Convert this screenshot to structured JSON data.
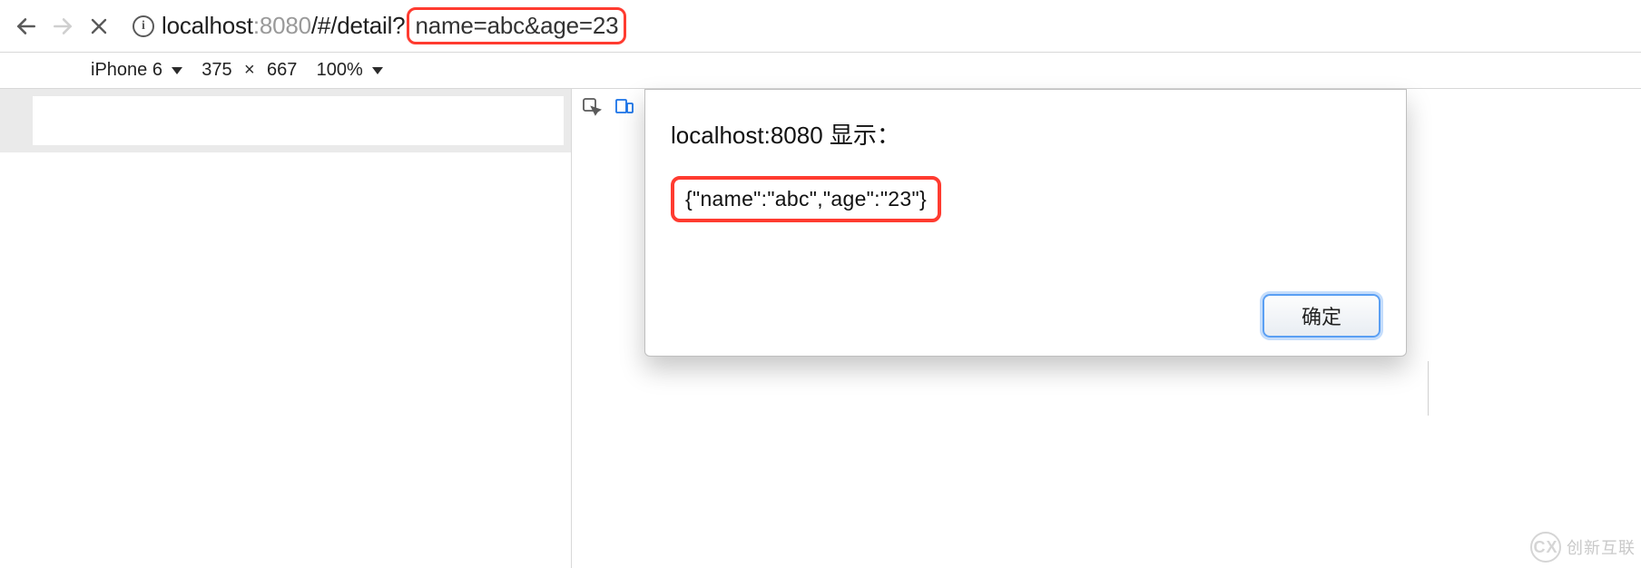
{
  "nav": {
    "back_enabled": true,
    "forward_enabled": false
  },
  "url": {
    "host": "localhost",
    "port": ":8080",
    "path": "/#/detail?",
    "query_highlight": "name=abc&age=23"
  },
  "device_bar": {
    "device": "iPhone 6",
    "width": "375",
    "height": "667",
    "zoom": "100%"
  },
  "alert": {
    "title": "localhost:8080 显示：",
    "body": "{\"name\":\"abc\",\"age\":\"23\"}",
    "ok_label": "确定"
  },
  "watermark": {
    "logo": "CX",
    "text": "创新互联"
  }
}
